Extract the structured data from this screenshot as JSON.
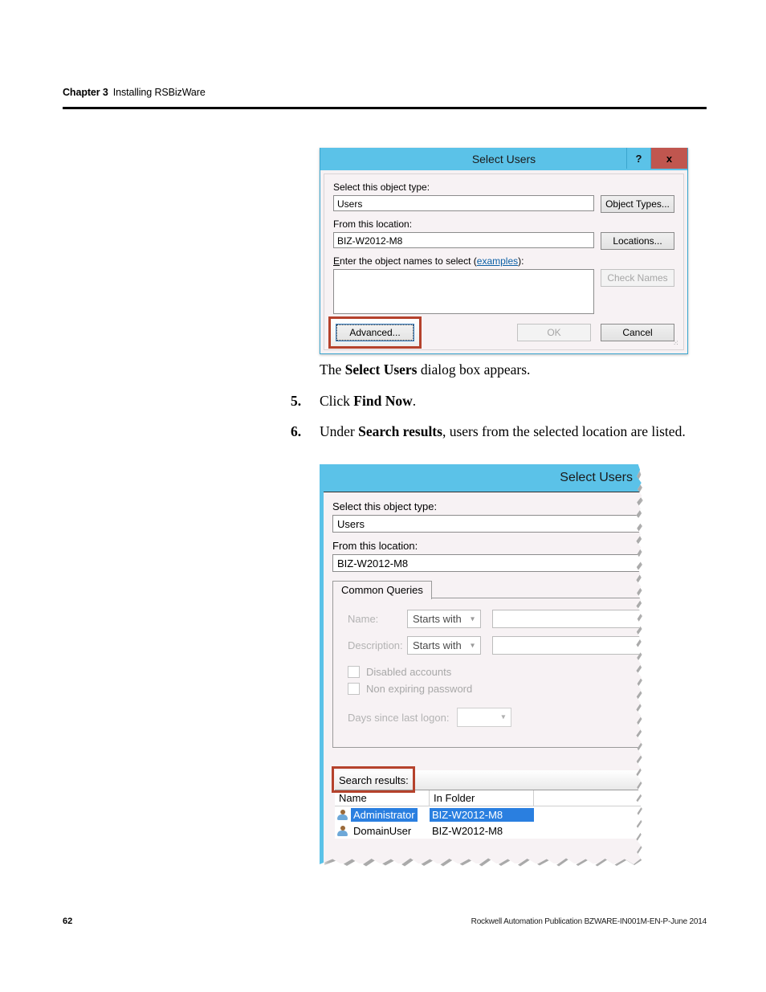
{
  "header": {
    "chapter_label": "Chapter 3",
    "chapter_title": "Installing RSBizWare"
  },
  "footer": {
    "page_number": "62",
    "publication": "Rockwell Automation Publication BZWARE-IN001M-EN-P-June 2014"
  },
  "body": {
    "intro": {
      "pre": "The ",
      "bold": "Select Users",
      "post": " dialog box appears."
    },
    "steps": [
      {
        "number": "5.",
        "pre": "Click ",
        "bold": "Find Now",
        "post": "."
      },
      {
        "number": "6.",
        "pre": "Under ",
        "bold": "Search results",
        "post": ", users from the selected location are listed."
      }
    ]
  },
  "dialog1": {
    "title": "Select Users",
    "help_button": "?",
    "close_button": "x",
    "object_type_label": "Select this object type:",
    "object_type_value": "Users",
    "object_types_button": "Object Types...",
    "location_label": "From this location:",
    "location_value": "BIZ-W2012-M8",
    "locations_button": "Locations...",
    "names_label_pre": "nter the object names to select (",
    "names_label_accel": "E",
    "names_label_link": "examples",
    "names_label_post": "):",
    "names_value": "",
    "check_names_button": "Check Names",
    "advanced_button": "Advanced...",
    "ok_button": "OK",
    "cancel_button": "Cancel",
    "annotation_color": "#b5422c"
  },
  "dialog2": {
    "title": "Select Users",
    "object_type_label": "Select this object type:",
    "object_type_value": "Users",
    "location_label": "From this location:",
    "location_value": "BIZ-W2012-M8",
    "tab_label": "Common Queries",
    "queries": [
      {
        "label": "Name:",
        "operator": "Starts with",
        "value": ""
      },
      {
        "label": "Description:",
        "operator": "Starts with",
        "value": ""
      }
    ],
    "checkboxes": [
      {
        "label": "Disabled accounts",
        "checked": false
      },
      {
        "label": "Non expiring password",
        "checked": false
      }
    ],
    "days_label": "Days since last logon:",
    "days_value": "",
    "search_results_label": "Search results:",
    "columns": [
      "Name",
      "In Folder",
      ""
    ],
    "rows": [
      {
        "name": "Administrator",
        "folder": "BIZ-W2012-M8",
        "selected": true
      },
      {
        "name": "DomainUser",
        "folder": "BIZ-W2012-M8",
        "selected": false
      }
    ],
    "annotation_color": "#b5422c",
    "selection_color": "#2a7fe0",
    "titlebar_color": "#5bc2e8"
  }
}
